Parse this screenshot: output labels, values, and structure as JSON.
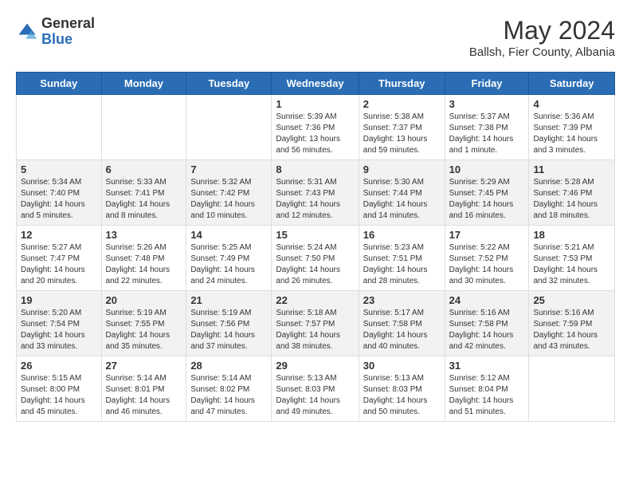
{
  "header": {
    "logo_general": "General",
    "logo_blue": "Blue",
    "month_title": "May 2024",
    "location": "Ballsh, Fier County, Albania"
  },
  "days_of_week": [
    "Sunday",
    "Monday",
    "Tuesday",
    "Wednesday",
    "Thursday",
    "Friday",
    "Saturday"
  ],
  "weeks": [
    [
      {
        "day": "",
        "info": ""
      },
      {
        "day": "",
        "info": ""
      },
      {
        "day": "",
        "info": ""
      },
      {
        "day": "1",
        "info": "Sunrise: 5:39 AM\nSunset: 7:36 PM\nDaylight: 13 hours and 56 minutes."
      },
      {
        "day": "2",
        "info": "Sunrise: 5:38 AM\nSunset: 7:37 PM\nDaylight: 13 hours and 59 minutes."
      },
      {
        "day": "3",
        "info": "Sunrise: 5:37 AM\nSunset: 7:38 PM\nDaylight: 14 hours and 1 minute."
      },
      {
        "day": "4",
        "info": "Sunrise: 5:36 AM\nSunset: 7:39 PM\nDaylight: 14 hours and 3 minutes."
      }
    ],
    [
      {
        "day": "5",
        "info": "Sunrise: 5:34 AM\nSunset: 7:40 PM\nDaylight: 14 hours and 5 minutes."
      },
      {
        "day": "6",
        "info": "Sunrise: 5:33 AM\nSunset: 7:41 PM\nDaylight: 14 hours and 8 minutes."
      },
      {
        "day": "7",
        "info": "Sunrise: 5:32 AM\nSunset: 7:42 PM\nDaylight: 14 hours and 10 minutes."
      },
      {
        "day": "8",
        "info": "Sunrise: 5:31 AM\nSunset: 7:43 PM\nDaylight: 14 hours and 12 minutes."
      },
      {
        "day": "9",
        "info": "Sunrise: 5:30 AM\nSunset: 7:44 PM\nDaylight: 14 hours and 14 minutes."
      },
      {
        "day": "10",
        "info": "Sunrise: 5:29 AM\nSunset: 7:45 PM\nDaylight: 14 hours and 16 minutes."
      },
      {
        "day": "11",
        "info": "Sunrise: 5:28 AM\nSunset: 7:46 PM\nDaylight: 14 hours and 18 minutes."
      }
    ],
    [
      {
        "day": "12",
        "info": "Sunrise: 5:27 AM\nSunset: 7:47 PM\nDaylight: 14 hours and 20 minutes."
      },
      {
        "day": "13",
        "info": "Sunrise: 5:26 AM\nSunset: 7:48 PM\nDaylight: 14 hours and 22 minutes."
      },
      {
        "day": "14",
        "info": "Sunrise: 5:25 AM\nSunset: 7:49 PM\nDaylight: 14 hours and 24 minutes."
      },
      {
        "day": "15",
        "info": "Sunrise: 5:24 AM\nSunset: 7:50 PM\nDaylight: 14 hours and 26 minutes."
      },
      {
        "day": "16",
        "info": "Sunrise: 5:23 AM\nSunset: 7:51 PM\nDaylight: 14 hours and 28 minutes."
      },
      {
        "day": "17",
        "info": "Sunrise: 5:22 AM\nSunset: 7:52 PM\nDaylight: 14 hours and 30 minutes."
      },
      {
        "day": "18",
        "info": "Sunrise: 5:21 AM\nSunset: 7:53 PM\nDaylight: 14 hours and 32 minutes."
      }
    ],
    [
      {
        "day": "19",
        "info": "Sunrise: 5:20 AM\nSunset: 7:54 PM\nDaylight: 14 hours and 33 minutes."
      },
      {
        "day": "20",
        "info": "Sunrise: 5:19 AM\nSunset: 7:55 PM\nDaylight: 14 hours and 35 minutes."
      },
      {
        "day": "21",
        "info": "Sunrise: 5:19 AM\nSunset: 7:56 PM\nDaylight: 14 hours and 37 minutes."
      },
      {
        "day": "22",
        "info": "Sunrise: 5:18 AM\nSunset: 7:57 PM\nDaylight: 14 hours and 38 minutes."
      },
      {
        "day": "23",
        "info": "Sunrise: 5:17 AM\nSunset: 7:58 PM\nDaylight: 14 hours and 40 minutes."
      },
      {
        "day": "24",
        "info": "Sunrise: 5:16 AM\nSunset: 7:58 PM\nDaylight: 14 hours and 42 minutes."
      },
      {
        "day": "25",
        "info": "Sunrise: 5:16 AM\nSunset: 7:59 PM\nDaylight: 14 hours and 43 minutes."
      }
    ],
    [
      {
        "day": "26",
        "info": "Sunrise: 5:15 AM\nSunset: 8:00 PM\nDaylight: 14 hours and 45 minutes."
      },
      {
        "day": "27",
        "info": "Sunrise: 5:14 AM\nSunset: 8:01 PM\nDaylight: 14 hours and 46 minutes."
      },
      {
        "day": "28",
        "info": "Sunrise: 5:14 AM\nSunset: 8:02 PM\nDaylight: 14 hours and 47 minutes."
      },
      {
        "day": "29",
        "info": "Sunrise: 5:13 AM\nSunset: 8:03 PM\nDaylight: 14 hours and 49 minutes."
      },
      {
        "day": "30",
        "info": "Sunrise: 5:13 AM\nSunset: 8:03 PM\nDaylight: 14 hours and 50 minutes."
      },
      {
        "day": "31",
        "info": "Sunrise: 5:12 AM\nSunset: 8:04 PM\nDaylight: 14 hours and 51 minutes."
      },
      {
        "day": "",
        "info": ""
      }
    ]
  ]
}
